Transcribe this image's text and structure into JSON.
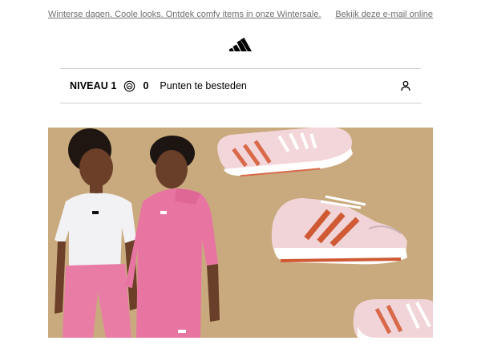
{
  "header": {
    "promo_link": "Winterse dagen. Coole looks. Ontdek comfy items in onze Wintersale.",
    "view_online": "Bekijk deze e-mail online"
  },
  "brand": {
    "logo_icon": "adidas-logo-icon"
  },
  "loyalty": {
    "level": "NIVEAU 1",
    "points_icon": "points-coin-icon",
    "points": "0",
    "points_label": "Punten te besteden",
    "account_icon": "user-icon"
  },
  "hero": {
    "icon": "kids-and-sneakers-image",
    "background": "#c9aa7e"
  },
  "colors": {
    "accent_pink": "#e8799f",
    "shoe_stripe": "#cf5a34",
    "text_muted": "#6f6f6f"
  }
}
